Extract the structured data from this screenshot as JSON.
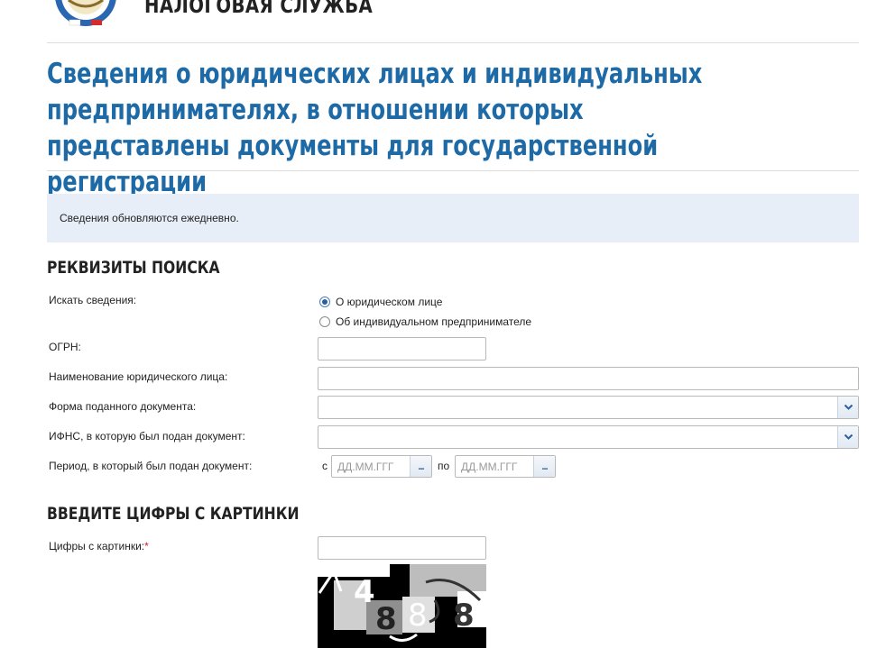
{
  "header": {
    "service_name": "НАЛОГОВАЯ СЛУЖБА"
  },
  "page": {
    "title": "Сведения о юридических лицах и индивидуальных предпринимателях, в отношении которых представлены документы для государственной регистрации",
    "notice": "Сведения обновляются ежедневно."
  },
  "search": {
    "section_title": "РЕКВИЗИТЫ ПОИСКА",
    "search_for_label": "Искать сведения:",
    "options": [
      {
        "label": "О юридическом лице",
        "checked": true
      },
      {
        "label": "Об индивидуальном предпринимателе",
        "checked": false
      }
    ],
    "ogrn_label": "ОГРН:",
    "ogrn_value": "",
    "name_label": "Наименование юридического лица:",
    "name_value": "",
    "doc_form_label": "Форма поданного документа:",
    "doc_form_value": "",
    "ifns_label": "ИФНС, в которую был подан документ:",
    "ifns_value": "",
    "period_label": "Период, в который был подан документ:",
    "period_from_prefix": "с",
    "period_to_prefix": "по",
    "date_placeholder": "ДД.ММ.ГГГ",
    "date_button": "..."
  },
  "captcha": {
    "section_title": "ВВЕДИТЕ ЦИФРЫ С КАРТИНКИ",
    "label": "Цифры с картинки:",
    "required_mark": "*",
    "value": "",
    "image_digits": "4888"
  },
  "colors": {
    "title_blue": "#1d6aa6",
    "notice_bg": "#e7eef8",
    "required_red": "#d21f1f"
  }
}
